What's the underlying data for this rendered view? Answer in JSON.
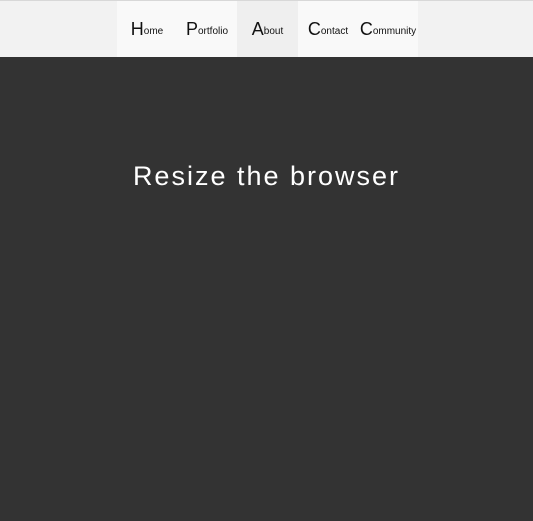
{
  "nav": {
    "items": [
      {
        "initial": "H",
        "rest": "ome"
      },
      {
        "initial": "P",
        "rest": "ortfolio"
      },
      {
        "initial": "A",
        "rest": "bout"
      },
      {
        "initial": "C",
        "rest": "ontact"
      },
      {
        "initial": "C",
        "rest": "ommunity"
      }
    ],
    "active": "About"
  },
  "main": {
    "heading": "Resize the browser"
  }
}
